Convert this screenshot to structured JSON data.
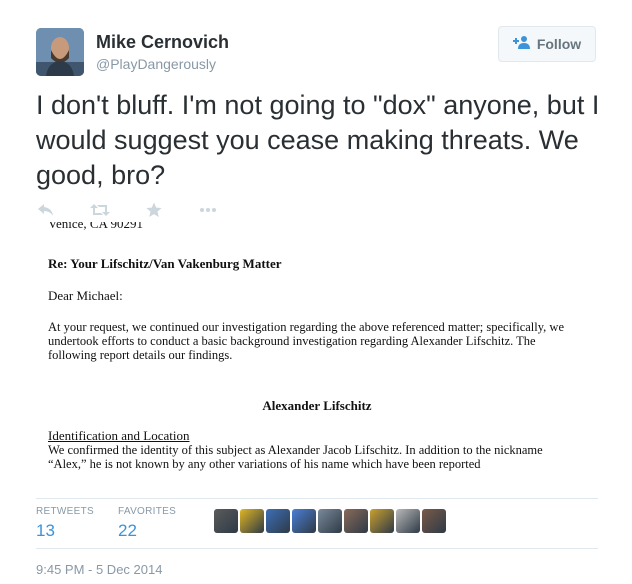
{
  "user": {
    "name": "Mike Cernovich",
    "handle": "@PlayDangerously"
  },
  "follow_button": {
    "label": "Follow"
  },
  "tweet": {
    "text": "I don't bluff. I'm not going to \"dox\" anyone, but I would suggest you cease making threats. We good, bro?"
  },
  "actions": [
    "reply-icon",
    "retweet-icon",
    "favorite-icon",
    "more-icon"
  ],
  "document": {
    "address_cut": "Venice, CA  90291",
    "re_line": "Re:  Your Lifschitz/Van Vakenburg Matter",
    "greeting": "Dear Michael:",
    "paragraph1": "At your request, we continued our investigation regarding the above referenced matter; specifically, we undertook efforts to conduct a basic background investigation regarding Alexander Lifschitz.  The following report details our findings.",
    "subject_name": "Alexander Lifschitz",
    "section_heading": "Identification and Location",
    "paragraph2": "We confirmed the identity of this subject as Alexander Jacob Lifschitz.  In addition to the nickname “Alex,” he is not known by any other variations of his name which have been reported"
  },
  "stats": {
    "retweets_label": "RETWEETS",
    "retweets_value": "13",
    "favorites_label": "FAVORITES",
    "favorites_value": "22"
  },
  "colors": {
    "link_blue": "#3b94d9",
    "muted_gray": "#8899a6",
    "text_dark": "#292f33",
    "button_bg": "#f5f8fa"
  },
  "favoriter_avatars": [
    "#5b5b5b",
    "#e0b623",
    "#3c6fb8",
    "#4a7fd6",
    "#7a8a9a",
    "#8a6a5a",
    "#caa030",
    "#b9b9b9",
    "#7a5a4a"
  ],
  "timestamp": "9:45 PM - 5 Dec 2014"
}
